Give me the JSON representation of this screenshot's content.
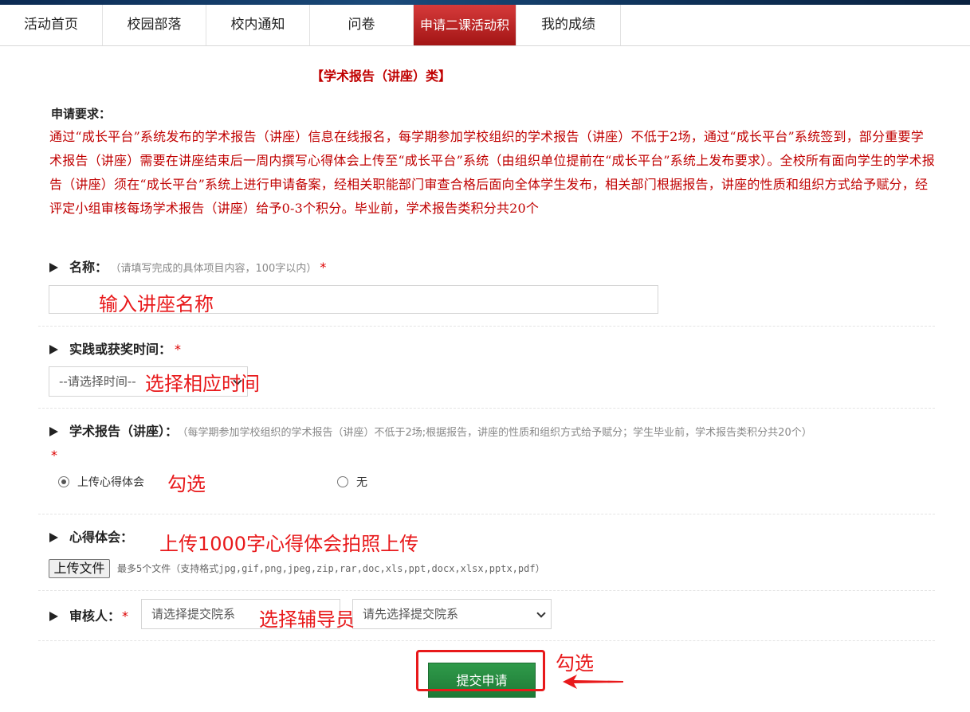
{
  "nav": {
    "tabs": [
      {
        "label": "活动首页"
      },
      {
        "label": "校园部落"
      },
      {
        "label": "校内通知"
      },
      {
        "label": "问卷"
      },
      {
        "label": "申请二课活动积"
      },
      {
        "label": "我的成绩"
      }
    ]
  },
  "section": {
    "title": "【学术报告（讲座）类】"
  },
  "requirements": {
    "label": "申请要求：",
    "text": "通过“成长平台”系统发布的学术报告（讲座）信息在线报名，每学期参加学校组织的学术报告（讲座）不低于2场，通过“成长平台”系统签到，部分重要学术报告（讲座）需要在讲座结束后一周内撰写心得体会上传至“成长平台”系统（由组织单位提前在“成长平台”系统上发布要求）。全校所有面向学生的学术报告（讲座）须在“成长平台”系统上进行申请备案，经相关职能部门审查合格后面向全体学生发布，相关部门根据报告，讲座的性质和组织方式给予赋分，经评定小组审核每场学术报告（讲座）给予0-3个积分。毕业前，学术报告类积分共20个"
  },
  "fields": {
    "name": {
      "label": "名称：",
      "hint": "（请填写完成的具体项目内容，100字以内）",
      "required": "*",
      "value": ""
    },
    "time": {
      "label": "实践或获奖时间：",
      "required": "*",
      "placeholder": "--请选择时间--"
    },
    "report": {
      "label": "学术报告（讲座）：",
      "hint": "（每学期参加学校组织的学术报告（讲座）不低于2场;根据报告，讲座的性质和组织方式给予赋分；学生毕业前，学术报告类积分共20个）",
      "required": "*",
      "options": [
        {
          "label": "上传心得体会",
          "selected": true
        },
        {
          "label": "无",
          "selected": false
        }
      ]
    },
    "experience": {
      "label": "心得体会：",
      "upload_label": "上传文件",
      "upload_hint": "最多5个文件（支持格式jpg,gif,png,jpeg,zip,rar,doc,xls,ppt,docx,xlsx,pptx,pdf）"
    },
    "reviewer": {
      "label": "审核人：",
      "required": "*",
      "dept_placeholder": "请选择提交院系",
      "person_placeholder": "请先选择提交院系"
    }
  },
  "submit": {
    "label": "提交申请"
  },
  "annotations": {
    "name": "输入讲座名称",
    "time": "选择相应时间",
    "radio": "勾选",
    "experience": "上传1000字心得体会拍照上传",
    "reviewer": "选择辅导员",
    "submit": "勾选"
  },
  "colors": {
    "accent_red": "#c00000",
    "annotation_red": "#e8191b",
    "submit_green": "#237f3c",
    "active_tab": "#b82222"
  }
}
